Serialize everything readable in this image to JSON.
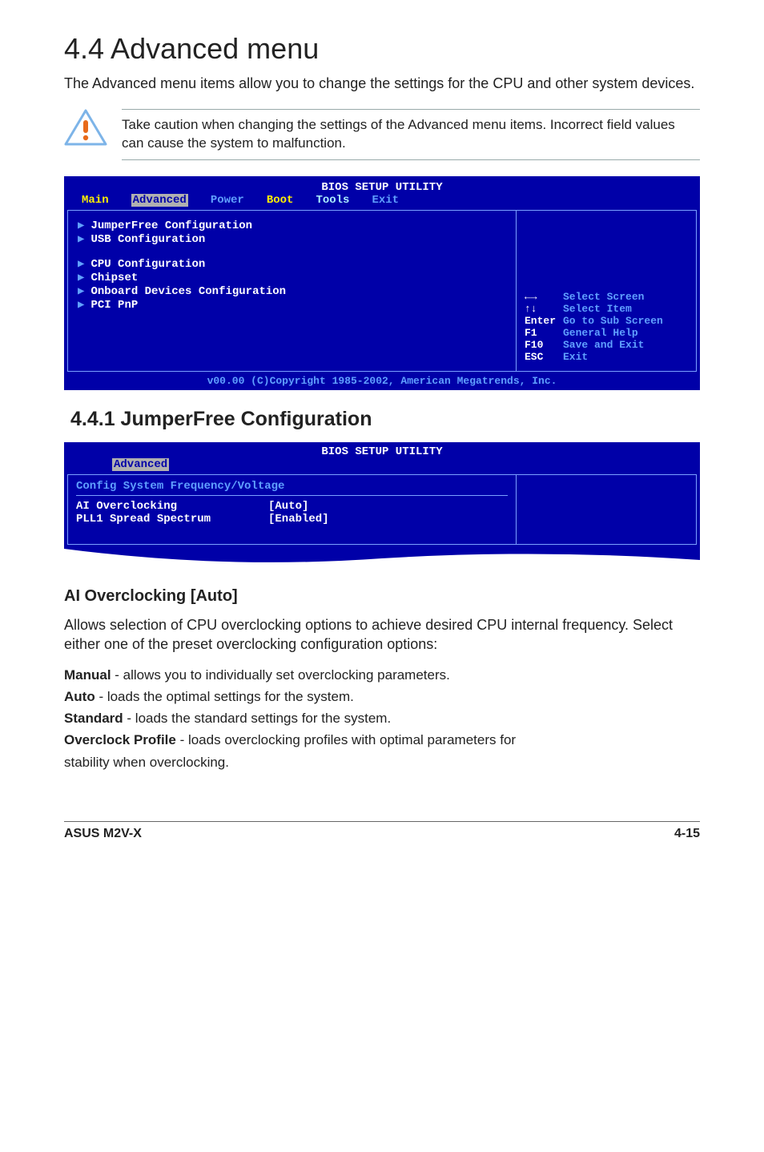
{
  "page": {
    "title": "4.4  Advanced menu",
    "intro": "The Advanced menu items allow you to change the settings for the CPU and other system devices.",
    "caution": "Take caution when changing the settings of the Advanced menu items. Incorrect field values can cause the system to malfunction."
  },
  "bios1": {
    "title": "BIOS SETUP UTILITY",
    "tabs": {
      "main": "Main",
      "advanced": "Advanced",
      "power": "Power",
      "boot": "Boot",
      "tools": "Tools",
      "exit": "Exit"
    },
    "items": [
      "JumperFree Configuration",
      "USB Configuration",
      "",
      "CPU Configuration",
      "Chipset",
      "Onboard Devices Configuration",
      "PCI PnP"
    ],
    "help": {
      "arrows_lr": "←→",
      "arrows_lr_lbl": "Select Screen",
      "arrows_ud": "↑↓",
      "arrows_ud_lbl": "Select Item",
      "enter": "Enter",
      "enter_lbl": "Go to Sub Screen",
      "f1": "F1",
      "f1_lbl": "General Help",
      "f10": "F10",
      "f10_lbl": "Save and Exit",
      "esc": "ESC",
      "esc_lbl": "Exit"
    },
    "footer": "v00.00 (C)Copyright 1985-2002, American Megatrends, Inc."
  },
  "section_4_4_1": {
    "title": "4.4.1  JumperFree Configuration"
  },
  "bios2": {
    "title": "BIOS SETUP UTILITY",
    "tab": "Advanced",
    "header": "Config System Frequency/Voltage",
    "rows": [
      {
        "label": "AI Overclocking",
        "value": "[Auto]"
      },
      {
        "label": "PLL1 Spread Spectrum",
        "value": "[Enabled]"
      }
    ]
  },
  "ai_oc": {
    "heading": "AI Overclocking [Auto]",
    "desc": "Allows selection of CPU overclocking options to achieve desired CPU internal frequency. Select either one of the preset overclocking configuration options:",
    "opts": {
      "manual_b": "Manual",
      "manual_t": " - allows you to individually set overclocking parameters.",
      "auto_b": "Auto",
      "auto_t": " - loads the optimal settings for the system.",
      "standard_b": "Standard",
      "standard_t": " - loads the standard settings for the system.",
      "ocp_b": "Overclock Profile",
      "ocp_t": " - loads overclocking profiles with optimal parameters for",
      "ocp_t2": "stability when overclocking."
    }
  },
  "footer": {
    "left": "ASUS M2V-X",
    "right": "4-15"
  }
}
